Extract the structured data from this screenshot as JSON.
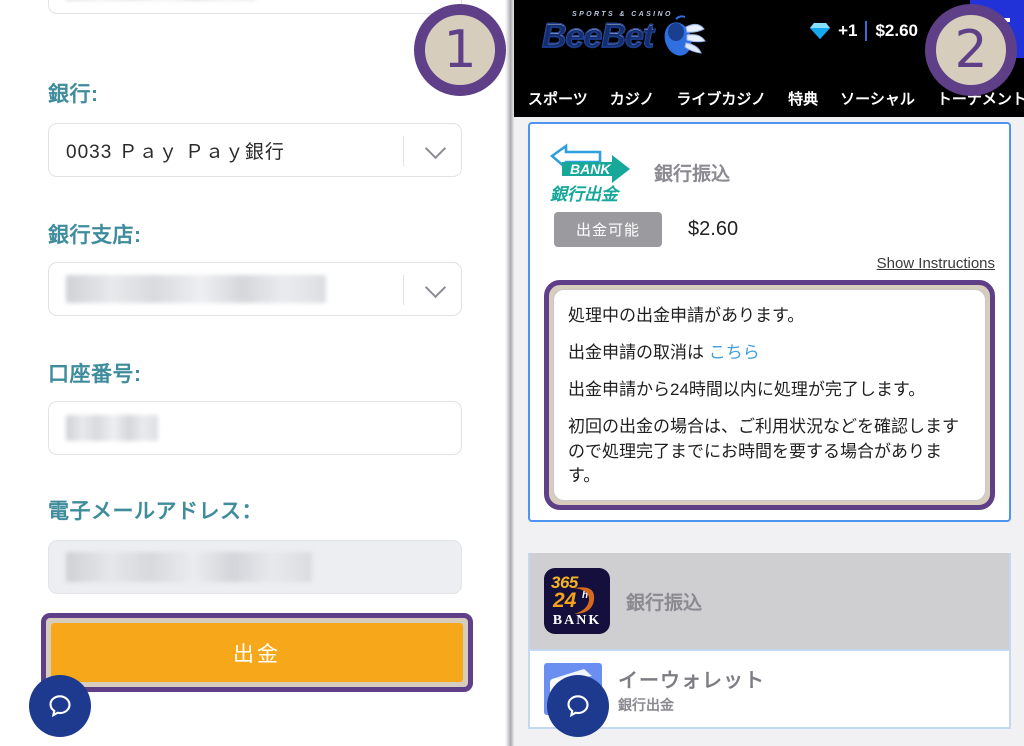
{
  "left_panel": {
    "fields": [
      {
        "label": "",
        "value": "",
        "type": "masked-input",
        "masked": true
      },
      {
        "label": "銀行:",
        "value": "0033 Ｐａｙ Ｐａｙ銀行",
        "type": "select",
        "masked": false
      },
      {
        "label": "銀行支店:",
        "value": "",
        "type": "select",
        "masked": true
      },
      {
        "label": "口座番号:",
        "value": "",
        "type": "input",
        "masked": true
      },
      {
        "label": "電子メールアドレス：",
        "value": "",
        "type": "input-readonly",
        "masked": true
      }
    ],
    "submit_button": "出金",
    "chat_icon": "chat-bubble-icon"
  },
  "right_panel": {
    "header": {
      "logo_text": "BeeBet",
      "logo_tagline": "SPORTS & CASINO",
      "mascot_icon": "bee-mascot-icon",
      "gem_icon": "diamond-gem-icon",
      "gem_count": "+1",
      "balance": "$2.60",
      "user_icon": "user-account-icon",
      "menu_icon": "hamburger-menu-icon"
    },
    "nav": [
      {
        "label": "スポーツ"
      },
      {
        "label": "カジノ"
      },
      {
        "label": "ライブカジノ"
      },
      {
        "label": "特典"
      },
      {
        "label": "ソーシャル"
      },
      {
        "label": "トーナメント"
      }
    ],
    "payment_card": {
      "logo_icon": "bank-withdrawal-icon",
      "logo_bank_word": "BANK",
      "logo_sub_jp": "銀行出金",
      "title": "銀行振込",
      "status_badge": "出金可能",
      "amount": "$2.60",
      "instructions_link": "Show Instructions",
      "notice": {
        "line1": "処理中の出金申請があります。",
        "line2_prefix": "出金申請の取消は ",
        "line2_link": "こちら",
        "line3": "出金申請から24時間以内に処理が完了します。",
        "line4": "初回の出金の場合は、ご利用状況などを確認しますので処理完了までにお時間を要する場合があります。"
      }
    },
    "bank365_row": {
      "logo_365": "365",
      "logo_24": "24",
      "logo_h": "h",
      "logo_bank": "BANK",
      "title": "銀行振込"
    },
    "ewallet_row": {
      "icon": "wallet-icon",
      "title": "イーウォレット",
      "subtitle": "銀行出金"
    },
    "chat_icon": "chat-bubble-icon"
  },
  "annotations": {
    "badge_1": "1",
    "badge_2": "2"
  },
  "colors": {
    "accent_purple": "#5f3f87",
    "badge_fill": "#d6cdbd",
    "label_teal": "#3f8c9d",
    "button_orange": "#f7a81a",
    "card_border_blue": "#4d95f0",
    "link_blue": "#3f9fd8",
    "bank_teal": "#17a89a",
    "chat_navy": "#1d3a8f"
  }
}
